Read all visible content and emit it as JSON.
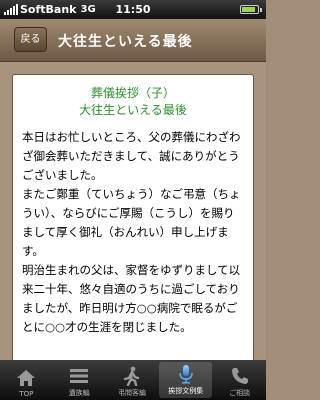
{
  "status_bar": {
    "carrier": "SoftBank",
    "network": "3G",
    "time": "11:50"
  },
  "nav": {
    "back_label": "戻る",
    "title": "大往生といえる最後"
  },
  "card": {
    "title_line1": "葬儀挨拶（子）",
    "title_line2": "大往生といえる最後",
    "paragraphs": [
      "本日はお忙しいところ、父の葬儀にわざわざ御会葬いただきまして、誠にありがとうございました。",
      "またご鄭重（ていちょう）なご弔意（ちょうい）、ならびにご厚賜（こうし）を賜りまして厚く御礼（おんれい）申し上げます。",
      "明治生まれの父は、家督をゆずりまして以来二十年、悠々自適のうちに過ごしておりましたが、昨日明け方○○病院で眠るがごとに○○才の生涯を閉じました。"
    ]
  },
  "tabs": [
    {
      "label": "TOP",
      "icon": "house-icon",
      "active": false
    },
    {
      "label": "遺族編",
      "icon": "list-icon",
      "active": false
    },
    {
      "label": "弔問客編",
      "icon": "walking-person-icon",
      "active": false
    },
    {
      "label": "挨拶文例集",
      "icon": "microphone-icon",
      "active": true
    },
    {
      "label": "ご相談",
      "icon": "phone-icon",
      "active": false
    }
  ],
  "colors": {
    "accent_title": "#2f8e2f",
    "nav_bar": "#8a735a",
    "background": "#a7937e"
  }
}
